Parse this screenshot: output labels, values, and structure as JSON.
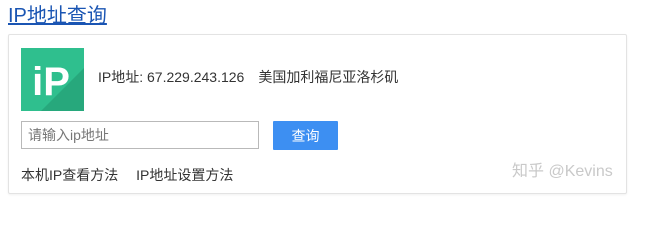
{
  "page": {
    "title": "IP地址查询"
  },
  "result": {
    "logo_text": "iP",
    "label": "IP地址:",
    "ip": "67.229.243.126",
    "location": "美国加利福尼亚洛杉矶"
  },
  "search": {
    "placeholder": "请输入ip地址",
    "value": "",
    "button_label": "查询"
  },
  "links": [
    {
      "label": "本机IP查看方法"
    },
    {
      "label": "IP地址设置方法"
    }
  ],
  "watermark": "知乎 @Kevins",
  "colors": {
    "title": "#1a55b3",
    "logo_bg": "#2fbf8e",
    "button_bg": "#3d8ff2"
  }
}
